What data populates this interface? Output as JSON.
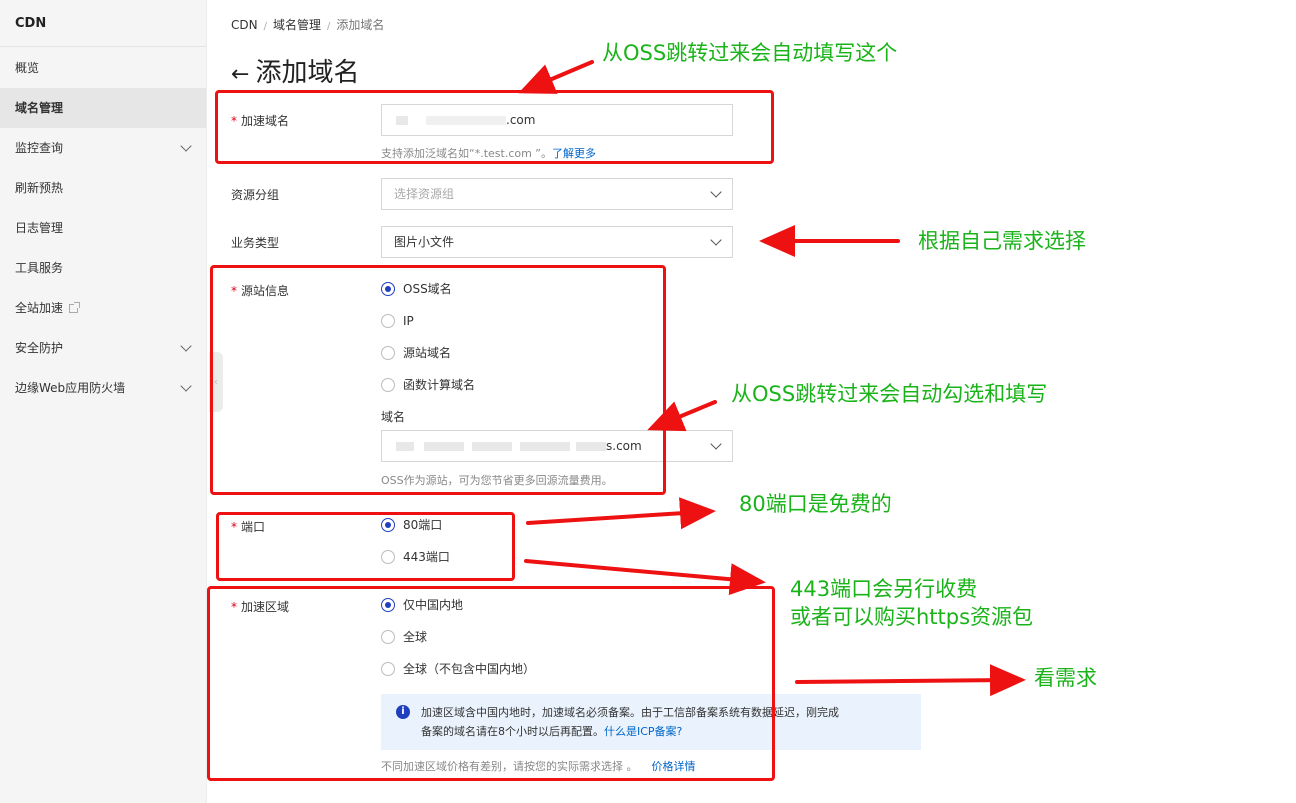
{
  "sidebar": {
    "title": "CDN",
    "items": [
      {
        "label": "概览"
      },
      {
        "label": "域名管理"
      },
      {
        "label": "监控查询"
      },
      {
        "label": "刷新预热"
      },
      {
        "label": "日志管理"
      },
      {
        "label": "工具服务"
      },
      {
        "label": "全站加速"
      },
      {
        "label": "安全防护"
      },
      {
        "label": "边缘Web应用防火墙"
      }
    ]
  },
  "breadcrumb": {
    "items": [
      "CDN",
      "域名管理",
      "添加域名"
    ]
  },
  "page": {
    "title": "添加域名",
    "back_icon": "←"
  },
  "form": {
    "domain": {
      "label": "加速域名",
      "value_suffix": ".com",
      "help": "支持添加泛域名如“*.test.com ”。",
      "help_link": "了解更多"
    },
    "resource_group": {
      "label": "资源分组",
      "placeholder": "选择资源组"
    },
    "business_type": {
      "label": "业务类型",
      "value": "图片小文件"
    },
    "origin": {
      "label": "源站信息",
      "options": [
        "OSS域名",
        "IP",
        "源站域名",
        "函数计算域名"
      ],
      "selected": "OSS域名",
      "domain_label": "域名",
      "domain_value_suffix": "s.com",
      "help": "OSS作为源站，可为您节省更多回源流量费用。"
    },
    "port": {
      "label": "端口",
      "options": [
        "80端口",
        "443端口"
      ],
      "selected": "80端口"
    },
    "region": {
      "label": "加速区域",
      "options": [
        "仅中国内地",
        "全球",
        "全球（不包含中国内地）"
      ],
      "selected": "仅中国内地",
      "notice_line1": "加速区域含中国内地时，加速域名必须备案。由于工信部备案系统有数据延迟，刚完成",
      "notice_line2": "备案的域名请在8个小时以后再配置。",
      "notice_link": "什么是ICP备案?",
      "price_note": "不同加速区域价格有差别，请按您的实际需求选择 。",
      "price_link": "价格详情"
    }
  },
  "annotations": {
    "a1": "从OSS跳转过来会自动填写这个",
    "a2": "根据自己需求选择",
    "a3": "从OSS跳转过来会自动勾选和填写",
    "a4": "80端口是免费的",
    "a5_line1": "443端口会另行收费",
    "a5_line2": "或者可以购买https资源包",
    "a6": "看需求"
  },
  "colors": {
    "annotation_text": "#1ab31a",
    "annotation_red": "#ee1111",
    "link": "#0064c8",
    "radio_checked": "#1f3fbf"
  }
}
